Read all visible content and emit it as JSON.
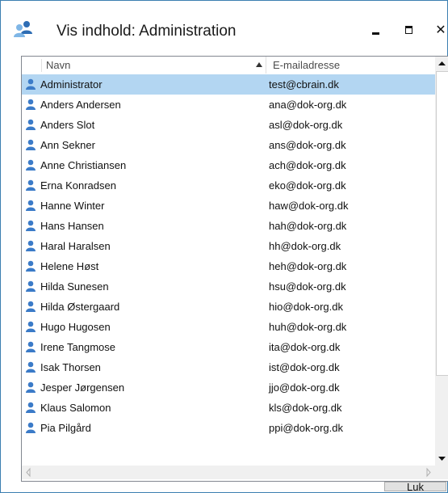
{
  "window": {
    "title": "Vis indhold: Administration",
    "controls": {
      "minimize": "–",
      "maximize": "□",
      "close": "×"
    }
  },
  "list": {
    "columns": [
      {
        "label": "Navn",
        "sort": "ascending"
      },
      {
        "label": "E-mailadresse"
      }
    ],
    "selected_index": 0,
    "rows": [
      {
        "name": "Administrator",
        "email": "test@cbrain.dk"
      },
      {
        "name": "Anders Andersen",
        "email": "ana@dok-org.dk"
      },
      {
        "name": "Anders Slot",
        "email": "asl@dok-org.dk"
      },
      {
        "name": "Ann Sekner",
        "email": "ans@dok-org.dk"
      },
      {
        "name": "Anne Christiansen",
        "email": "ach@dok-org.dk"
      },
      {
        "name": "Erna Konradsen",
        "email": "eko@dok-org.dk"
      },
      {
        "name": "Hanne Winter",
        "email": "haw@dok-org.dk"
      },
      {
        "name": "Hans Hansen",
        "email": "hah@dok-org.dk"
      },
      {
        "name": "Haral Haralsen",
        "email": "hh@dok-org.dk"
      },
      {
        "name": "Helene Høst",
        "email": "heh@dok-org.dk"
      },
      {
        "name": "Hilda Sunesen",
        "email": "hsu@dok-org.dk"
      },
      {
        "name": "Hilda Østergaard",
        "email": "hio@dok-org.dk"
      },
      {
        "name": "Hugo Hugosen",
        "email": "huh@dok-org.dk"
      },
      {
        "name": "Irene Tangmose",
        "email": "ita@dok-org.dk"
      },
      {
        "name": "Isak Thorsen",
        "email": "ist@dok-org.dk"
      },
      {
        "name": "Jesper Jørgensen",
        "email": "jjo@dok-org.dk"
      },
      {
        "name": "Klaus Salomon",
        "email": "kls@dok-org.dk"
      },
      {
        "name": "Pia Pilgård",
        "email": "ppi@dok-org.dk"
      }
    ]
  },
  "footer": {
    "close_button": "Luk"
  },
  "icons": {
    "title": "group-icon",
    "row": "user-icon"
  },
  "colors": {
    "selection": "#b3d6f2",
    "user_icon": "#3b7bc8",
    "border": "#3c7fb1"
  }
}
